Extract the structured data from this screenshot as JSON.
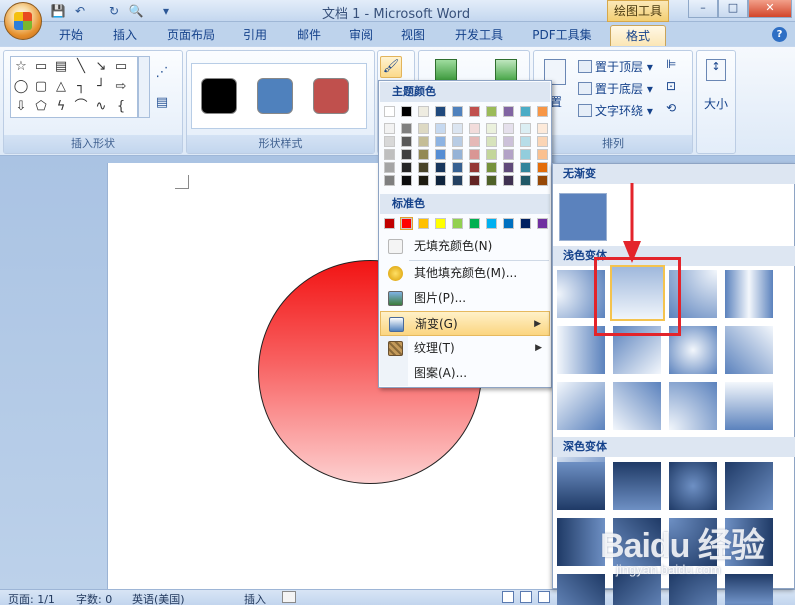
{
  "window": {
    "title": "文档 1 - Microsoft Word",
    "context_tab": "绘图工具",
    "minimize": "–",
    "maximize": "□",
    "close": "✕"
  },
  "quick_access": {
    "save_icon": "💾",
    "undo_icon": "↶",
    "redo_icon": "↻",
    "preview_icon": "🔍",
    "more_icon": "▾"
  },
  "tabs": [
    {
      "label": "开始"
    },
    {
      "label": "插入"
    },
    {
      "label": "页面布局"
    },
    {
      "label": "引用"
    },
    {
      "label": "邮件"
    },
    {
      "label": "审阅"
    },
    {
      "label": "视图"
    },
    {
      "label": "开发工具"
    },
    {
      "label": "PDF工具集"
    },
    {
      "label": "格式",
      "active": true
    }
  ],
  "help_icon": "?",
  "ribbon": {
    "insert_shapes_label": "插入形状",
    "shape_styles_label": "形状样式",
    "arrange_label": "排列",
    "size_label": "大小",
    "arrange_items": [
      "置于顶层 ▾",
      "置于底层 ▾",
      "文字环绕 ▾"
    ],
    "arrange_partial": "置",
    "style_swatches": [
      "#000000",
      "#4f81bd",
      "#c0504d"
    ]
  },
  "fill_menu": {
    "theme_colors_header": "主题颜色",
    "theme_colors": [
      [
        "#ffffff",
        "#000000",
        "#eeece1",
        "#1f497d",
        "#4f81bd",
        "#c0504d",
        "#9bbb59",
        "#8064a2",
        "#4bacc6",
        "#f79646"
      ],
      [
        "#f2f2f2",
        "#7f7f7f",
        "#ddd9c3",
        "#c6d9f0",
        "#dbe5f1",
        "#f2dcdb",
        "#ebf1dd",
        "#e5e0ec",
        "#dbeef3",
        "#fdeada"
      ],
      [
        "#d8d8d8",
        "#595959",
        "#c4bd97",
        "#8db3e2",
        "#b8cce4",
        "#e5b9b7",
        "#d7e3bc",
        "#ccc1d9",
        "#b7dde8",
        "#fbd5b5"
      ],
      [
        "#bfbfbf",
        "#3f3f3f",
        "#938953",
        "#548dd4",
        "#95b3d7",
        "#d99694",
        "#c3d69b",
        "#b2a2c7",
        "#92cddc",
        "#fac08f"
      ],
      [
        "#a5a5a5",
        "#262626",
        "#494429",
        "#17365d",
        "#366092",
        "#953734",
        "#76923c",
        "#5f497a",
        "#31859b",
        "#e36c09"
      ],
      [
        "#7f7f7f",
        "#0c0c0c",
        "#1d1b10",
        "#0f243e",
        "#244061",
        "#632423",
        "#4f6128",
        "#3f3151",
        "#205867",
        "#974806"
      ]
    ],
    "standard_colors_header": "标准色",
    "standard_colors": [
      "#c00000",
      "#ff0000",
      "#ffc000",
      "#ffff00",
      "#92d050",
      "#00b050",
      "#00b0f0",
      "#0070c0",
      "#002060",
      "#7030a0"
    ],
    "no_fill": "无填充颜色(N)",
    "more_colors": "其他填充颜色(M)...",
    "picture": "图片(P)...",
    "gradient": "渐变(G)",
    "texture": "纹理(T)",
    "pattern": "图案(A)..."
  },
  "gradient_menu": {
    "no_gradient": "无渐变",
    "light_variations": "浅色变体",
    "dark_variations": "深色变体"
  },
  "statusbar": {
    "page": "页面: 1/1",
    "words": "字数: 0",
    "language": "英语(美国)",
    "mode": "插入"
  },
  "watermark": {
    "brand": "Baidu 经验",
    "url": "jingyan.baidu.com"
  }
}
